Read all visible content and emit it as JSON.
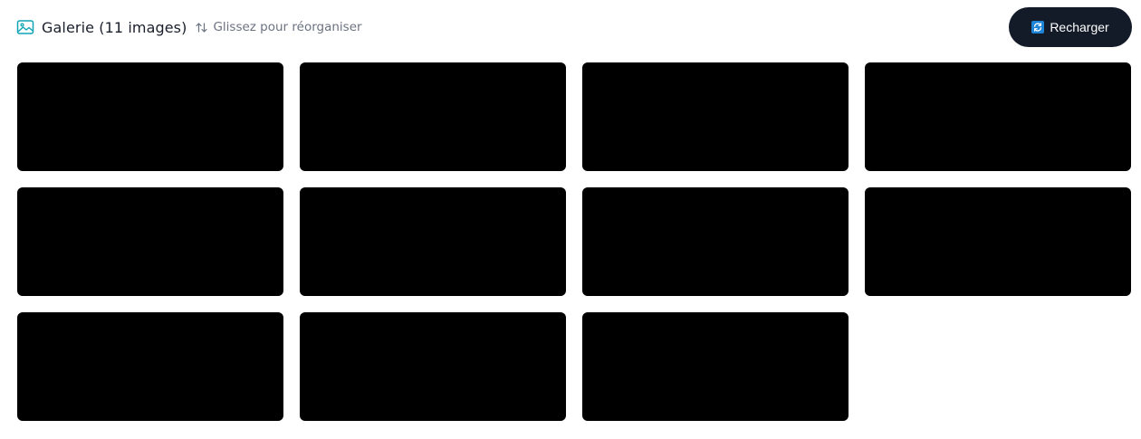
{
  "header": {
    "title": "Galerie (11 images)",
    "hint": "Glissez pour réorganiser",
    "gallery_icon": "image-icon",
    "sort_icon": "arrows-up-down-icon"
  },
  "toolbar": {
    "reload_label": "Recharger",
    "reload_icon": "refresh-icon"
  },
  "gallery": {
    "image_count": 11,
    "tiles": [
      {
        "color": "#000000"
      },
      {
        "color": "#000000"
      },
      {
        "color": "#000000"
      },
      {
        "color": "#000000"
      },
      {
        "color": "#000000"
      },
      {
        "color": "#000000"
      },
      {
        "color": "#000000"
      },
      {
        "color": "#000000"
      },
      {
        "color": "#000000"
      },
      {
        "color": "#000000"
      },
      {
        "color": "#000000"
      }
    ]
  },
  "colors": {
    "accent": "#0ea5b7",
    "button_bg": "#131a28",
    "title_text": "#1a1f2b",
    "hint_text": "#6b7280",
    "reload_icon_bg": "#1d84d8"
  }
}
